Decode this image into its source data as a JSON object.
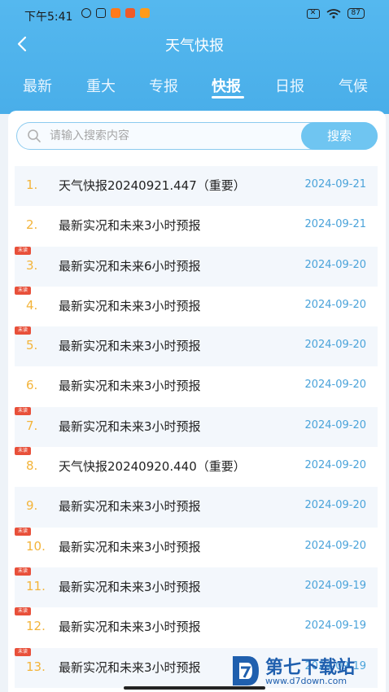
{
  "status_bar": {
    "time": "下午5:41",
    "sim": "✕",
    "battery": "87"
  },
  "nav": {
    "title": "天气快报"
  },
  "tabs": [
    {
      "label": "最新",
      "active": false
    },
    {
      "label": "重大",
      "active": false
    },
    {
      "label": "专报",
      "active": false
    },
    {
      "label": "快报",
      "active": true
    },
    {
      "label": "日报",
      "active": false
    },
    {
      "label": "气候",
      "active": false
    }
  ],
  "search": {
    "placeholder": "请输入搜索内容",
    "button_label": "搜索"
  },
  "badge_label": "未读",
  "items": [
    {
      "num": "1.",
      "title": "天气快报20240921.447（重要）",
      "date": "2024-09-21",
      "unread": false
    },
    {
      "num": "2.",
      "title": "最新实况和未来3小时预报",
      "date": "2024-09-21",
      "unread": false
    },
    {
      "num": "3.",
      "title": "最新实况和未来6小时预报",
      "date": "2024-09-20",
      "unread": true
    },
    {
      "num": "4.",
      "title": "最新实况和未来3小时预报",
      "date": "2024-09-20",
      "unread": true
    },
    {
      "num": "5.",
      "title": "最新实况和未来3小时预报",
      "date": "2024-09-20",
      "unread": true
    },
    {
      "num": "6.",
      "title": "最新实况和未来3小时预报",
      "date": "2024-09-20",
      "unread": false
    },
    {
      "num": "7.",
      "title": "最新实况和未来3小时预报",
      "date": "2024-09-20",
      "unread": true
    },
    {
      "num": "8.",
      "title": "天气快报20240920.440（重要）",
      "date": "2024-09-20",
      "unread": true
    },
    {
      "num": "9.",
      "title": "最新实况和未来3小时预报",
      "date": "2024-09-20",
      "unread": false
    },
    {
      "num": "10.",
      "title": "最新实况和未来3小时预报",
      "date": "2024-09-20",
      "unread": true
    },
    {
      "num": "11.",
      "title": "最新实况和未来3小时预报",
      "date": "2024-09-19",
      "unread": true
    },
    {
      "num": "12.",
      "title": "最新实况和未来3小时预报",
      "date": "2024-09-19",
      "unread": true
    },
    {
      "num": "13.",
      "title": "最新实况和未来3小时预报",
      "date": "2024-09-19",
      "unread": true
    }
  ],
  "watermark": {
    "title": "第七下载站",
    "url": "www.d7down.com"
  },
  "colors": {
    "header": "#4fb3ec",
    "accent": "#4aa3da",
    "number": "#f3b43a",
    "badge": "#e8503a"
  }
}
